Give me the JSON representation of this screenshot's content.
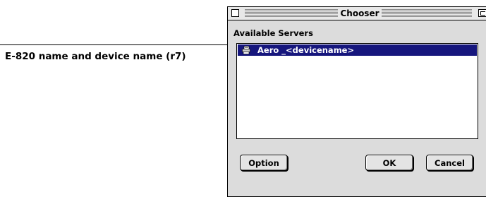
{
  "callout": {
    "text": "E-820 name and device name (r7)"
  },
  "window": {
    "title": "Chooser",
    "list_label": "Available Servers",
    "servers": [
      {
        "label": "Aero _<devicename>",
        "selected": true,
        "icon": "printer-icon"
      }
    ],
    "buttons": {
      "option": "Option",
      "ok": "OK",
      "cancel": "Cancel"
    }
  },
  "colors": {
    "selection": "#16167d",
    "window_bg": "#dcdcdc"
  }
}
